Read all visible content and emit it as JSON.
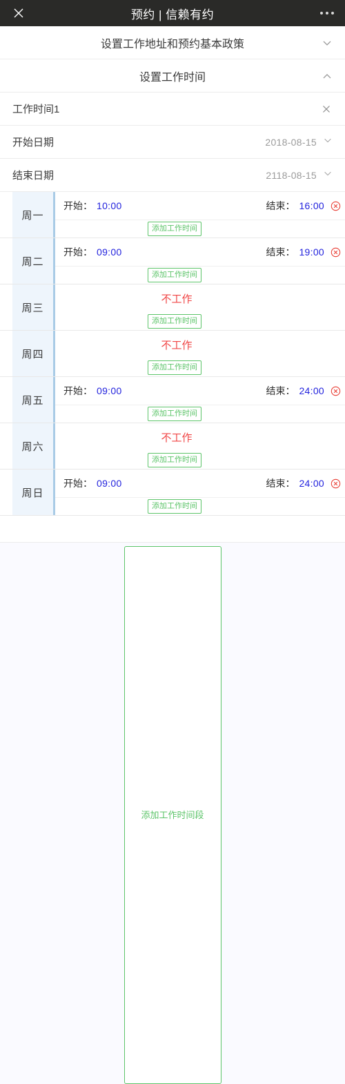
{
  "appbar": {
    "title": "预约 | 信赖有约",
    "close_icon": "close-icon",
    "more_icon": "more-options-icon"
  },
  "sections": [
    {
      "title": "设置工作地址和预约基本政策",
      "state": "collapsed",
      "chevron": "chevron-down-icon"
    },
    {
      "title": "设置工作时间",
      "state": "expanded",
      "chevron": "chevron-up-icon"
    }
  ],
  "work_period": {
    "name": "工作时间1",
    "remove_icon": "close-icon",
    "start_date": {
      "label": "开始日期",
      "value": "2018-08-15",
      "chevron": "chevron-down-icon"
    },
    "end_date": {
      "label": "结束日期",
      "value": "2118-08-15",
      "chevron": "chevron-down-icon"
    }
  },
  "labels": {
    "start": "开始：",
    "end": "结束：",
    "off_work": "不工作",
    "add_slot": "添加工作时间",
    "delete_icon": "delete-circle-icon"
  },
  "schedule": [
    {
      "day": "周一",
      "working": true,
      "start": "10:00",
      "end": "16:00"
    },
    {
      "day": "周二",
      "working": true,
      "start": "09:00",
      "end": "19:00"
    },
    {
      "day": "周三",
      "working": false,
      "start": "",
      "end": ""
    },
    {
      "day": "周四",
      "working": false,
      "start": "",
      "end": ""
    },
    {
      "day": "周五",
      "working": true,
      "start": "09:00",
      "end": "24:00"
    },
    {
      "day": "周六",
      "working": false,
      "start": "",
      "end": ""
    },
    {
      "day": "周日",
      "working": true,
      "start": "09:00",
      "end": "24:00"
    }
  ],
  "footer": {
    "add_period_label": "添加工作时间段"
  },
  "colors": {
    "appbar_bg": "#2a2a28",
    "time_value": "#2222dd",
    "off_work": "#f04444",
    "add_button": "#5cc469",
    "day_cell_bg": "#eef5fc",
    "day_cell_accent": "#a9cbe6"
  }
}
